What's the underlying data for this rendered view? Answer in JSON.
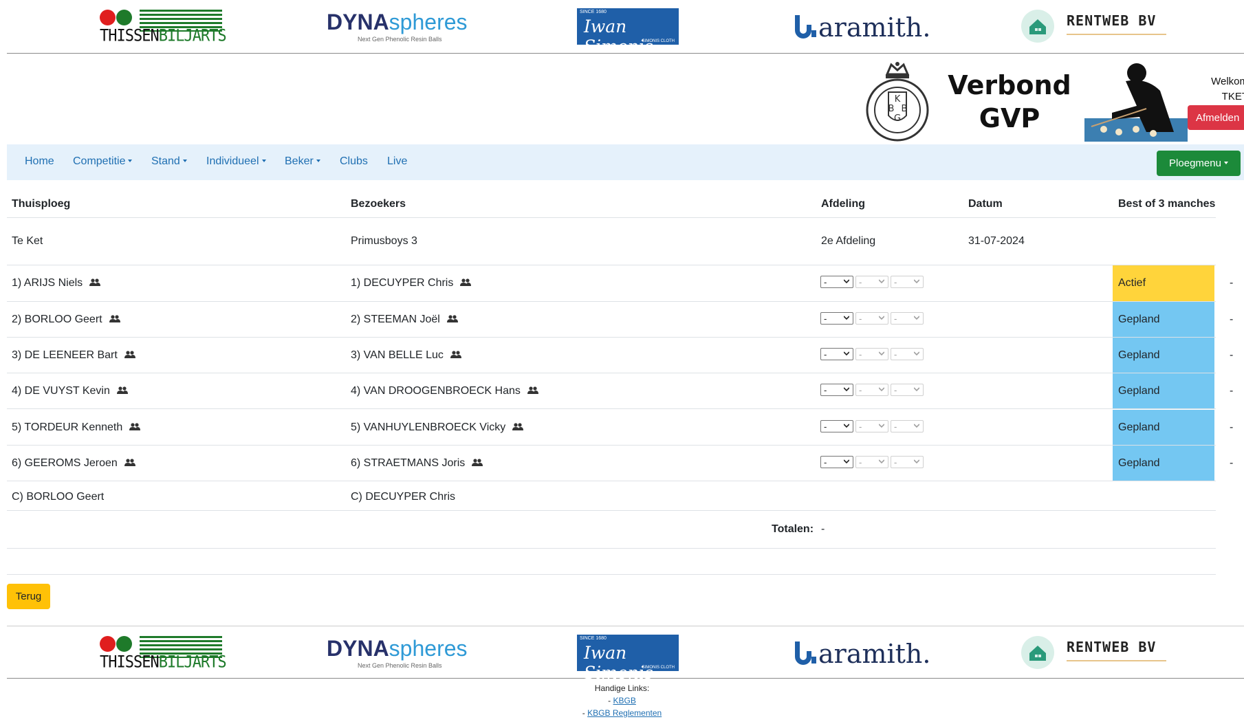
{
  "sponsors": {
    "thissen": {
      "left": "THISSEN",
      "right": "BILJARTS"
    },
    "dyna": {
      "main_bold": "DYNA",
      "main_light": "spheres",
      "sub": "Next Gen Phenolic Resin Balls"
    },
    "simonis": {
      "since": "SINCE 1680",
      "script": "Iwan Simonis",
      "cloth": "SIMONIS CLOTH"
    },
    "aramith": {
      "name": "aramith."
    },
    "rentweb": {
      "name": "RENTWEB BV"
    }
  },
  "header": {
    "title_line1": "Verbond",
    "title_line2": "GVP",
    "welcome_line1": "Welkom",
    "welcome_line2": "TKET",
    "logout": "Afmelden"
  },
  "nav": {
    "home": "Home",
    "competitie": "Competitie",
    "stand": "Stand",
    "individueel": "Individueel",
    "beker": "Beker",
    "clubs": "Clubs",
    "live": "Live",
    "team_menu": "Ploegmenu"
  },
  "table": {
    "headers": {
      "home": "Thuisploeg",
      "visitors": "Bezoekers",
      "division": "Afdeling",
      "date": "Datum",
      "format": "Best of 3 manches"
    },
    "match": {
      "home": "Te Ket",
      "visitors": "Primusboys 3",
      "division": "2e Afdeling",
      "date": "31-07-2024"
    },
    "games": [
      {
        "home": "1) ARIJS Niels",
        "away": "1) DECUYPER Chris",
        "s1": "-",
        "s2": "-",
        "s3": "-",
        "status": "Actief",
        "end": "-"
      },
      {
        "home": "2) BORLOO Geert",
        "away": "2) STEEMAN Joël",
        "s1": "-",
        "s2": "-",
        "s3": "-",
        "status": "Gepland",
        "end": "-"
      },
      {
        "home": "3) DE LEENEER Bart",
        "away": "3) VAN BELLE Luc",
        "s1": "-",
        "s2": "-",
        "s3": "-",
        "status": "Gepland",
        "end": "-"
      },
      {
        "home": "4) DE VUYST Kevin",
        "away": "4) VAN DROOGENBROECK Hans",
        "s1": "-",
        "s2": "-",
        "s3": "-",
        "status": "Gepland",
        "end": "-"
      },
      {
        "home": "5) TORDEUR Kenneth",
        "away": "5) VANHUYLENBROECK Vicky",
        "s1": "-",
        "s2": "-",
        "s3": "-",
        "status": "Gepland",
        "end": "-"
      },
      {
        "home": "6) GEEROMS Jeroen",
        "away": "6) STRAETMANS Joris",
        "s1": "-",
        "s2": "-",
        "s3": "-",
        "status": "Gepland",
        "end": "-"
      }
    ],
    "captains": {
      "home": "C) BORLOO Geert",
      "away": "C) DECUYPER Chris"
    },
    "totals_label": "Totalen:",
    "totals_value": "-"
  },
  "colors": {
    "active": "#ffd43b",
    "planned": "#74c7f2",
    "nav_bg": "#e5f1fb",
    "link": "#1f6fb2"
  },
  "back_button": "Terug",
  "footer": {
    "title": "Handige Links:",
    "link1": "KBGB",
    "link2": "KBGB Reglementen"
  }
}
